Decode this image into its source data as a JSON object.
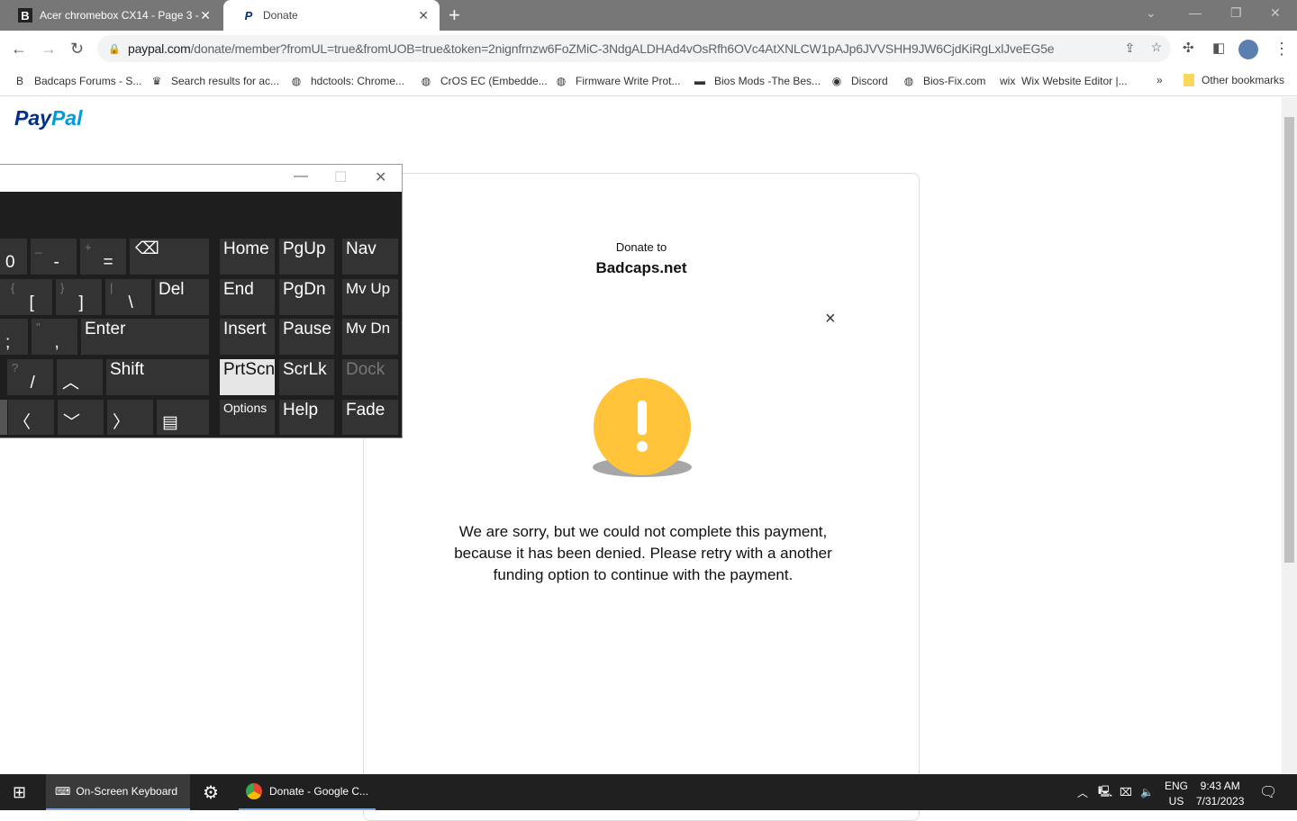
{
  "browser": {
    "tabs": [
      {
        "title": "Acer chromebox CX14 - Page 3 -",
        "favicon": "B"
      },
      {
        "title": "Donate",
        "favicon": "P"
      }
    ],
    "url_host": "paypal.com",
    "url_path": "/donate/member?fromUL=true&fromUOB=true&token=2nignfrnzw6FoZMiC-3NdgALDHAd4vOsRfh6OVc4AtXNLCW1pAJp6JVVSHH9JW6CjdKiRgLxlJveEG5e",
    "bookmarks": [
      {
        "label": "Badcaps Forums - S...",
        "icon": "B"
      },
      {
        "label": "Search results for ac...",
        "icon": "♛"
      },
      {
        "label": "hdctools: Chrome...",
        "icon": "◍"
      },
      {
        "label": "CrOS EC (Embedde...",
        "icon": "◍"
      },
      {
        "label": "Firmware Write Prot...",
        "icon": "◍"
      },
      {
        "label": "Bios Mods -The Bes...",
        "icon": "▬"
      },
      {
        "label": "Discord",
        "icon": "◉"
      },
      {
        "label": "Bios-Fix.com",
        "icon": "◍"
      },
      {
        "label": "Wix Website Editor |...",
        "icon": "wix"
      }
    ],
    "more_bookmarks": "»",
    "other_bookmarks": "Other bookmarks"
  },
  "page": {
    "logo_a": "Pay",
    "logo_b": "Pal",
    "donate_to": "Donate to",
    "org": "Badcaps.net",
    "close": "×",
    "message": "We are sorry, but we could not complete this payment, because it has been denied. Please retry with a another funding option to continue with the payment.",
    "warning_color": "#ffc439"
  },
  "osk": {
    "keys": [
      {
        "main": "0"
      },
      {
        "main": "-",
        "sub": "_"
      },
      {
        "main": "=",
        "sub": "+"
      },
      {
        "main": "⌫"
      },
      {
        "main": "Home"
      },
      {
        "main": "PgUp"
      },
      {
        "main": "Nav"
      },
      {
        "main": ""
      },
      {
        "main": "[",
        "sub": "{"
      },
      {
        "main": "]",
        "sub": "}"
      },
      {
        "main": "\\",
        "sub": "|"
      },
      {
        "main": "Del"
      },
      {
        "main": "End"
      },
      {
        "main": "PgDn"
      },
      {
        "main": "Mv Up"
      },
      {
        "main": ";"
      },
      {
        "main": ",",
        "sub": "\""
      },
      {
        "main": "Enter"
      },
      {
        "main": "Insert"
      },
      {
        "main": "Pause"
      },
      {
        "main": "Mv Dn"
      },
      {
        "main": "/",
        "sub": "?"
      },
      {
        "main": "︿"
      },
      {
        "main": "Shift"
      },
      {
        "main": "PrtScn"
      },
      {
        "main": "ScrLk"
      },
      {
        "main": "Dock"
      },
      {
        "main": ""
      },
      {
        "main": "〈"
      },
      {
        "main": "﹀"
      },
      {
        "main": "〉"
      },
      {
        "main": "▤"
      },
      {
        "main": "Options"
      },
      {
        "main": "Help"
      },
      {
        "main": "Fade"
      }
    ]
  },
  "taskbar": {
    "items": [
      {
        "label": "On-Screen Keyboard"
      },
      {
        "label": ""
      },
      {
        "label": "Donate - Google C..."
      }
    ],
    "lang": "ENG",
    "region": "US",
    "time": "9:43 AM",
    "date": "7/31/2023"
  }
}
